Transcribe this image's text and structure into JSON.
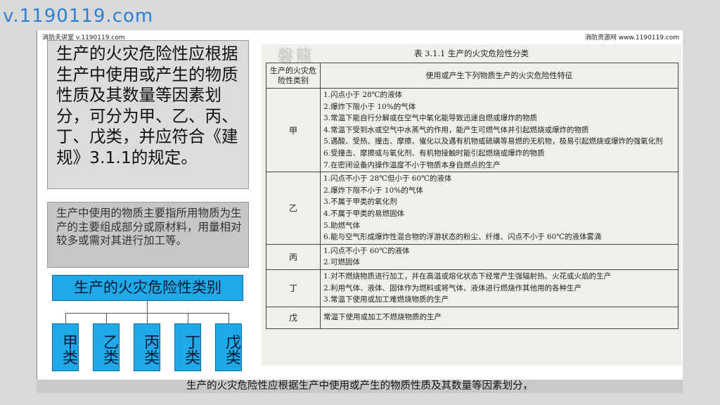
{
  "watermark_top": "v.1190119.com",
  "slide": {
    "watermark_left": "消防夫讲堂 v.1190119.com",
    "watermark_right": "消防资源网 www.1190119.com",
    "main_text": "生产的火灾危险性应根据生产中使用或产生的物质性质及其数量等因素划分，可分为甲、乙、丙、丁、戊类，并应符合《建规》3.1.1的规定。",
    "note_text": "生产中使用的物质主要指所用物质为生产的主要组成部分或原材料，用量相对较多或需对其进行加工等。",
    "category_title": "生产的火灾危险性类别",
    "categories": [
      "甲类",
      "乙类",
      "丙类",
      "丁类",
      "戊类"
    ],
    "stamp_text": "磐龍",
    "table": {
      "caption": "表 3.1.1 生产的火灾危险性分类",
      "header_class": "生产的火灾危险性类别",
      "header_feature": "使用或产生下列物质生产的火灾危险性特征",
      "rows": [
        {
          "class": "甲",
          "lines": [
            "1.闪点小于 28℃的液体",
            "2.爆炸下限小于 10%的气体",
            "3.常温下能自行分解或在空气中氧化能导致迅速自燃或爆炸的物质",
            "4.常温下受到水或空气中水蒸气的作用，能产生可燃气体并引起燃烧或爆炸的物质",
            "5.遇酸、受热、撞击、摩擦、催化以及遇有机物或硫磺等易燃的无机物，极易引起燃烧或爆炸的强氧化剂",
            "6.受撞击、摩擦或与氧化剂、有机物接触时能引起燃烧或爆炸的物质",
            "7.在密闭设备内操作温度不小于物质本身自燃点的生产"
          ]
        },
        {
          "class": "乙",
          "lines": [
            "1.闪点不小于 28℃但小于 60℃的液体",
            "2.爆炸下限不小于 10%的气体",
            "3.不属于甲类的氧化剂",
            "4.不属于甲类的易燃固体",
            "5.助燃气体",
            "6.能与空气形成爆炸性混合物的浮游状态的粉尘、纤维、闪点不小于 60℃的液体雾滴"
          ]
        },
        {
          "class": "丙",
          "lines": [
            "1.闪点不小于 60℃的液体",
            "2.可燃固体"
          ]
        },
        {
          "class": "丁",
          "lines": [
            "1.对不燃烧物质进行加工，并在高温或熔化状态下经常产生强辐射热、火花或火焰的生产",
            "2.利用气体、液体、固体作为燃料或将气体、液体进行燃烧作其他用的各种生产",
            "3.常温下使用或加工难燃烧物质的生产"
          ]
        },
        {
          "class": "戊",
          "lines": [
            "常温下使用或加工不燃烧物质的生产"
          ]
        }
      ]
    },
    "subtitle": "生产的火灾危险性应根据生产中使用或产生的物质性质及其数量等因素划分，"
  }
}
